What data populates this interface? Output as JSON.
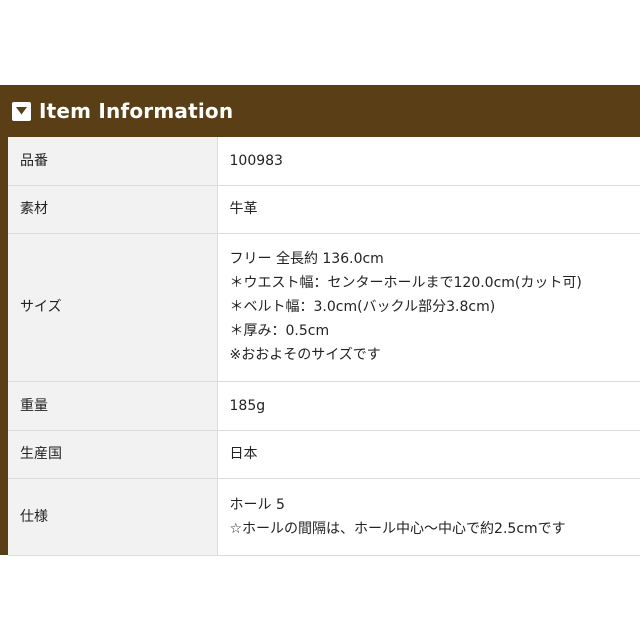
{
  "header": {
    "title": "Item Information",
    "icon": "caret-down-icon"
  },
  "colors": {
    "header_bg": "#5a3e16",
    "label_bg": "#f2f2f2",
    "border": "#dcdcdc"
  },
  "rows": [
    {
      "label": "品番",
      "lines": [
        "100983"
      ]
    },
    {
      "label": "素材",
      "lines": [
        "牛革"
      ]
    },
    {
      "label": "サイズ",
      "lines": [
        "フリー 全長約 136.0cm",
        "＊ウエスト幅：センターホールまで120.0cm(カット可)",
        "＊ベルト幅：3.0cm(バックル部分3.8cm)",
        "＊厚み：0.5cm",
        "※おおよそのサイズです"
      ]
    },
    {
      "label": "重量",
      "lines": [
        "185g"
      ]
    },
    {
      "label": "生産国",
      "lines": [
        "日本"
      ]
    },
    {
      "label": "仕様",
      "lines": [
        "ホール 5",
        "☆ホールの間隔は、ホール中心～中心で約2.5cmです"
      ]
    }
  ]
}
